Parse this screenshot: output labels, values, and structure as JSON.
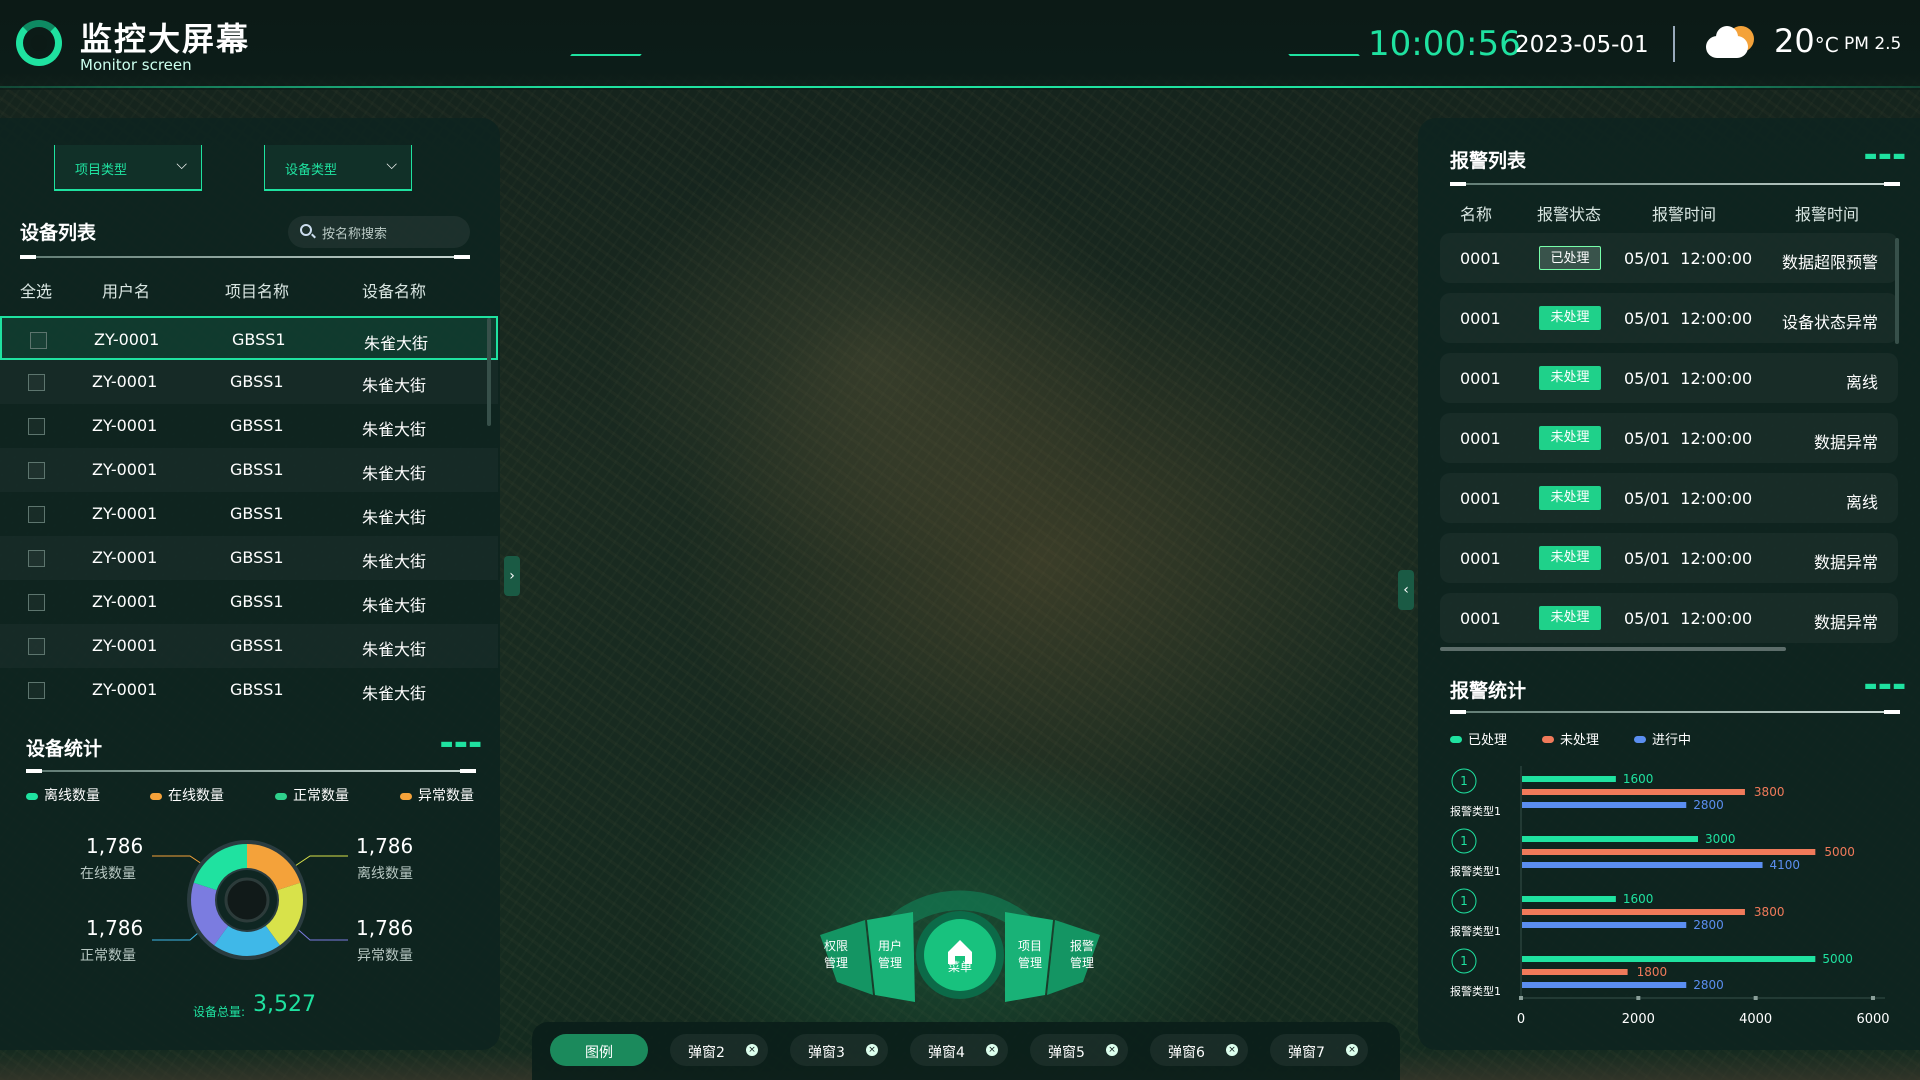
{
  "header": {
    "title": "监控大屏幕",
    "subtitle": "Monitor screen",
    "time": "10:00:56",
    "date": "2023-05-01",
    "temp": "20",
    "temp_unit": "°C",
    "pm": "PM 2.5"
  },
  "filters": {
    "project_type": "项目类型",
    "device_type": "设备类型"
  },
  "device_list": {
    "title": "设备列表",
    "search_placeholder": "按名称搜索",
    "columns": [
      "全选",
      "用户名",
      "项目名称",
      "设备名称"
    ],
    "rows": [
      {
        "user": "ZY-0001",
        "project": "GBSS1",
        "device": "朱雀大街"
      },
      {
        "user": "ZY-0001",
        "project": "GBSS1",
        "device": "朱雀大街"
      },
      {
        "user": "ZY-0001",
        "project": "GBSS1",
        "device": "朱雀大街"
      },
      {
        "user": "ZY-0001",
        "project": "GBSS1",
        "device": "朱雀大街"
      },
      {
        "user": "ZY-0001",
        "project": "GBSS1",
        "device": "朱雀大街"
      },
      {
        "user": "ZY-0001",
        "project": "GBSS1",
        "device": "朱雀大街"
      },
      {
        "user": "ZY-0001",
        "project": "GBSS1",
        "device": "朱雀大街"
      },
      {
        "user": "ZY-0001",
        "project": "GBSS1",
        "device": "朱雀大街"
      },
      {
        "user": "ZY-0001",
        "project": "GBSS1",
        "device": "朱雀大街"
      }
    ]
  },
  "device_stats": {
    "title": "设备统计",
    "legend": [
      "离线数量",
      "在线数量",
      "正常数量",
      "异常数量"
    ],
    "legend_colors": [
      "#1fe2a0",
      "#f4a23a",
      "#2fd18c",
      "#f4a23a"
    ],
    "online": {
      "value": "1,786",
      "label": "在线数量"
    },
    "offline": {
      "value": "1,786",
      "label": "离线数量"
    },
    "normal": {
      "value": "1,786",
      "label": "正常数量"
    },
    "abnormal": {
      "value": "1,786",
      "label": "异常数量"
    },
    "total_label": "设备总量:",
    "total": "3,527",
    "donut_colors": [
      "#f4a23a",
      "#d8e24a",
      "#3fb8e8",
      "#7b7ce0",
      "#1fe2a0"
    ]
  },
  "alarm_list": {
    "title": "报警列表",
    "columns": [
      "名称",
      "报警状态",
      "报警时间",
      "报警时间"
    ],
    "rows": [
      {
        "name": "0001",
        "status": "已处理",
        "state": "done",
        "time": "05/01  12:00:00",
        "type": "数据超限预警"
      },
      {
        "name": "0001",
        "status": "未处理",
        "state": "todo",
        "time": "05/01  12:00:00",
        "type": "设备状态异常"
      },
      {
        "name": "0001",
        "status": "未处理",
        "state": "todo",
        "time": "05/01  12:00:00",
        "type": "离线"
      },
      {
        "name": "0001",
        "status": "未处理",
        "state": "todo",
        "time": "05/01  12:00:00",
        "type": "数据异常"
      },
      {
        "name": "0001",
        "status": "未处理",
        "state": "todo",
        "time": "05/01  12:00:00",
        "type": "离线"
      },
      {
        "name": "0001",
        "status": "未处理",
        "state": "todo",
        "time": "05/01  12:00:00",
        "type": "数据异常"
      },
      {
        "name": "0001",
        "status": "未处理",
        "state": "todo",
        "time": "05/01  12:00:00",
        "type": "数据异常"
      }
    ]
  },
  "alarm_stats": {
    "title": "报警统计"
  },
  "chart_data": {
    "type": "bar",
    "orientation": "horizontal",
    "categories": [
      "报警类型1",
      "报警类型1",
      "报警类型1",
      "报警类型1"
    ],
    "rank_labels": [
      "1",
      "1",
      "1",
      "1"
    ],
    "series": [
      {
        "name": "已处理",
        "color": "#1fe2a0",
        "values": [
          1600,
          3000,
          1600,
          5000
        ]
      },
      {
        "name": "未处理",
        "color": "#f07a5a",
        "values": [
          3800,
          5000,
          3800,
          1800
        ]
      },
      {
        "name": "进行中",
        "color": "#5b8ef0",
        "values": [
          2800,
          4100,
          2800,
          2800
        ]
      }
    ],
    "xticks": [
      "0",
      "2000",
      "4000",
      "6000"
    ],
    "xlim": [
      0,
      6000
    ],
    "grid": false,
    "legend_position": "top-left"
  },
  "menu": {
    "center": "菜单",
    "items": [
      "权限\n管理",
      "用户\n管理",
      "项目\n管理",
      "报警\n管理"
    ]
  },
  "tabs": [
    "图例",
    "弹窗2",
    "弹窗3",
    "弹窗4",
    "弹窗5",
    "弹窗6",
    "弹窗7"
  ]
}
